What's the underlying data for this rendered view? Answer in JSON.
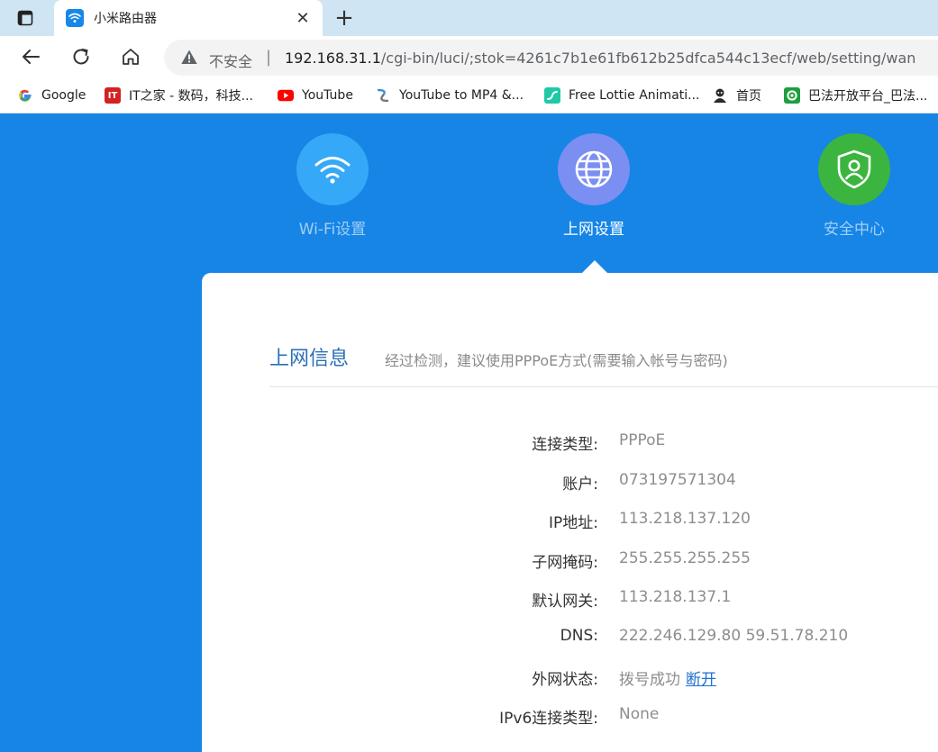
{
  "browser": {
    "tab_title": "小米路由器",
    "address": {
      "security_label": "不安全",
      "url_host": "192.168.31.1",
      "url_path": "/cgi-bin/luci/;stok=4261c7b1e61fb612b25dfca544c13ecf/web/setting/wan"
    },
    "bookmarks": [
      {
        "label": "Google",
        "icon": "google-icon"
      },
      {
        "label": "IT之家 - 数码，科技...",
        "icon": "ithome-icon"
      },
      {
        "label": "YouTube",
        "icon": "youtube-icon"
      },
      {
        "label": "YouTube to MP4 &...",
        "icon": "converter-icon"
      },
      {
        "label": "Free Lottie Animati...",
        "icon": "lottie-icon"
      },
      {
        "label": "首页",
        "icon": "home-page-icon"
      },
      {
        "label": "巴法开放平台_巴法...",
        "icon": "bafa-icon"
      }
    ]
  },
  "router": {
    "categories": [
      {
        "label": "Wi-Fi设置",
        "icon": "wifi-icon",
        "color": "#35a8f7"
      },
      {
        "label": "上网设置",
        "icon": "globe-icon",
        "color": "#7b8ef2"
      },
      {
        "label": "安全中心",
        "icon": "shield-user-icon",
        "color": "#3bb53f"
      }
    ],
    "panel": {
      "title": "上网信息",
      "hint": "经过检测，建议使用PPPoE方式(需要输入帐号与密码)",
      "rows": [
        {
          "label": "连接类型:",
          "value": "PPPoE"
        },
        {
          "label": "账户:",
          "value": "073197571304"
        },
        {
          "label": "IP地址:",
          "value": "113.218.137.120"
        },
        {
          "label": "子网掩码:",
          "value": "255.255.255.255"
        },
        {
          "label": "默认网关:",
          "value": "113.218.137.1"
        },
        {
          "label": "DNS:",
          "value": "222.246.129.80 59.51.78.210"
        },
        {
          "label": "外网状态:",
          "value": "拨号成功",
          "action": "断开"
        },
        {
          "label": "IPv6连接类型:",
          "value": "None"
        }
      ]
    }
  }
}
